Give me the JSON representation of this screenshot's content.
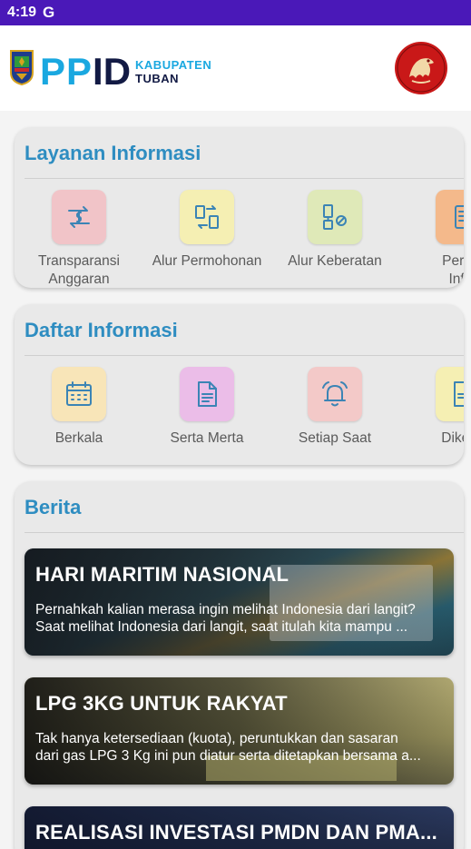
{
  "status_bar": {
    "time": "4:19",
    "google_icon": "G"
  },
  "header": {
    "logo_pp": "PP",
    "logo_id": "ID",
    "logo_kabupaten": "KABUPATEN",
    "logo_tuban": "TUBAN"
  },
  "layanan": {
    "title": "Layanan Informasi",
    "items": [
      {
        "label_line1": "Transparansi",
        "label_line2": "Anggaran",
        "icon": "transfer-dollar-icon",
        "color": "#f1c4c8"
      },
      {
        "label_line1": "Alur Permohonan",
        "label_line2": "",
        "icon": "flow-request-icon",
        "color": "#f5efb3"
      },
      {
        "label_line1": "Alur Keberatan",
        "label_line2": "",
        "icon": "flow-objection-icon",
        "color": "#dfe9b8"
      },
      {
        "label_line1": "Permo",
        "label_line2": "Infor",
        "icon": "document-request-icon",
        "color": "#f4b98b"
      }
    ]
  },
  "daftar": {
    "title": "Daftar Informasi",
    "items": [
      {
        "label": "Berkala",
        "icon": "calendar-icon",
        "color": "#f8e5b8"
      },
      {
        "label": "Serta Merta",
        "icon": "document-icon",
        "color": "#ebbde8"
      },
      {
        "label": "Setiap Saat",
        "icon": "bell-icon",
        "color": "#f3c9c8"
      },
      {
        "label": "Dikecu",
        "icon": "file-icon",
        "color": "#f5efb3"
      }
    ]
  },
  "berita": {
    "title": "Berita",
    "items": [
      {
        "title": "HARI MARITIM NASIONAL",
        "desc_line1": "Pernahkah kalian merasa ingin melihat Indonesia dari langit?",
        "desc_line2": "Saat melihat Indonesia dari langit, saat itulah kita mampu ..."
      },
      {
        "title": "LPG 3KG UNTUK RAKYAT",
        "desc_line1": "Tak hanya ketersediaan (kuota), peruntukkan dan sasaran",
        "desc_line2": "dari gas LPG 3 Kg ini pun diatur serta ditetapkan bersama a..."
      },
      {
        "title": "REALISASI INVESTASI PMDN DAN PMA...",
        "desc_line1": "",
        "desc_line2": ""
      }
    ]
  }
}
